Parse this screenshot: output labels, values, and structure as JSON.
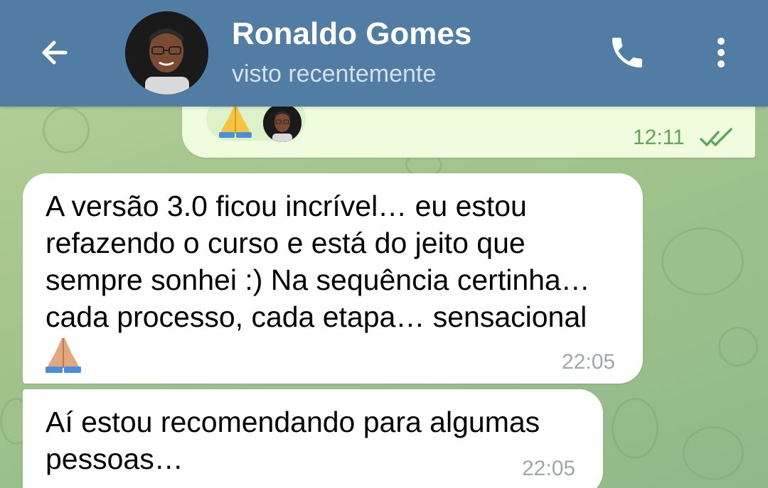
{
  "header": {
    "contact_name": "Ronaldo Gomes",
    "status": "visto recentemente",
    "background_color": "#517ca3",
    "icons": {
      "back": "arrow-left-icon",
      "call": "phone-icon",
      "menu": "more-vertical-icon"
    }
  },
  "messages": [
    {
      "direction": "outgoing",
      "reaction": "folded-hands-emoji",
      "time": "12:11",
      "read": true
    },
    {
      "direction": "incoming",
      "lines": [
        "A versão 3.0 ficou incrível… eu estou",
        "refazendo o curso e está do jeito que",
        "sempre sonhei :) Na sequência certinha…",
        "cada processo, cada etapa… sensacional"
      ],
      "emoji": "folded-hands-emoji",
      "time": "22:05"
    },
    {
      "direction": "incoming",
      "lines": [
        "Aí estou recomendando para algumas",
        "pessoas…"
      ],
      "time": "22:05"
    }
  ],
  "colors": {
    "outgoing_bubble": "#effdde",
    "incoming_bubble": "#ffffff",
    "outgoing_time": "#5fa65a",
    "incoming_time": "#a0a6ab"
  }
}
